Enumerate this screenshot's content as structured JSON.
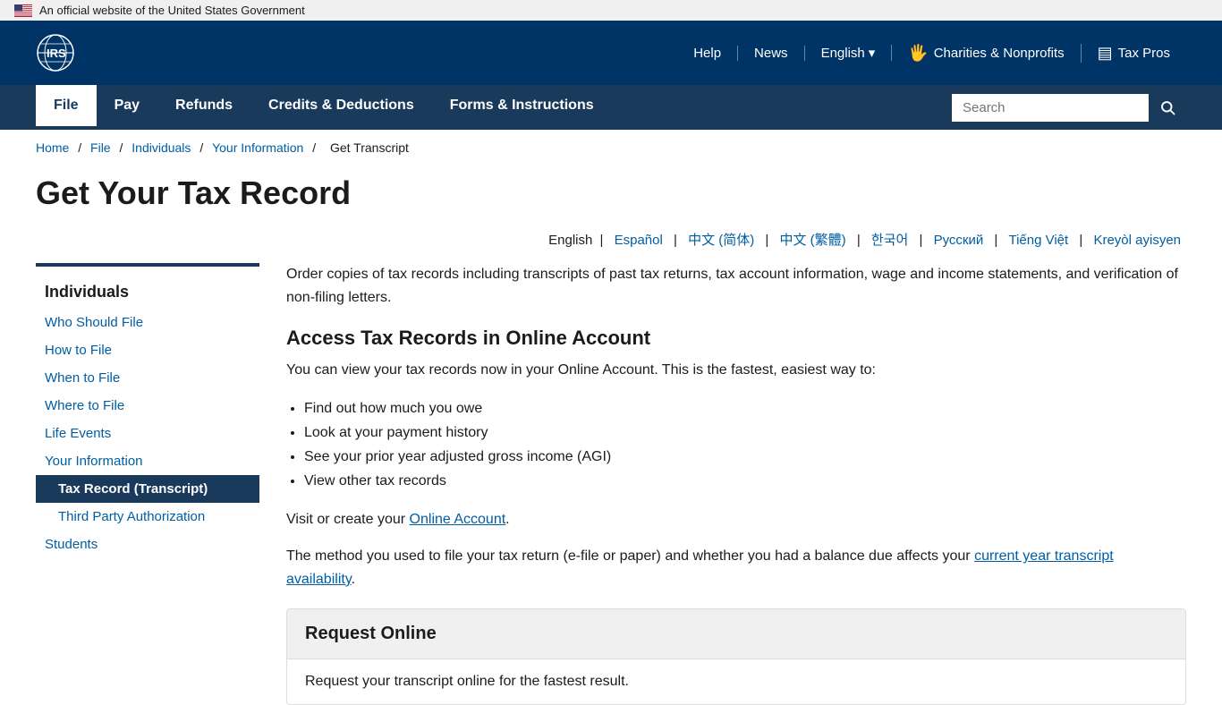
{
  "gov_banner": {
    "text": "An official website of the United States Government"
  },
  "header": {
    "logo_text": "IRS",
    "nav_links": [
      {
        "label": "Help",
        "id": "help"
      },
      {
        "label": "News",
        "id": "news"
      },
      {
        "label": "English",
        "id": "english",
        "has_dropdown": true
      },
      {
        "label": "Charities & Nonprofits",
        "id": "charities"
      },
      {
        "label": "Tax Pros",
        "id": "tax-pros"
      }
    ]
  },
  "main_nav": {
    "items": [
      {
        "label": "File",
        "id": "file",
        "active": true
      },
      {
        "label": "Pay",
        "id": "pay"
      },
      {
        "label": "Refunds",
        "id": "refunds"
      },
      {
        "label": "Credits & Deductions",
        "id": "credits"
      },
      {
        "label": "Forms & Instructions",
        "id": "forms"
      }
    ],
    "search_placeholder": "Search"
  },
  "breadcrumb": {
    "items": [
      {
        "label": "Home",
        "href": "#"
      },
      {
        "label": "File",
        "href": "#"
      },
      {
        "label": "Individuals",
        "href": "#"
      },
      {
        "label": "Your Information",
        "href": "#"
      },
      {
        "label": "Get Transcript",
        "href": null
      }
    ]
  },
  "page_title": "Get Your Tax Record",
  "lang_bar": {
    "current": "English",
    "links": [
      {
        "label": "Español"
      },
      {
        "label": "中文 (简体)"
      },
      {
        "label": "中文 (繁體)"
      },
      {
        "label": "한국어"
      },
      {
        "label": "Русский"
      },
      {
        "label": "Tiếng Việt"
      },
      {
        "label": "Kreyòl ayisyen"
      }
    ]
  },
  "sidebar": {
    "title": "Individuals",
    "items": [
      {
        "label": "Who Should File",
        "id": "who-should-file",
        "active": false,
        "sub": false
      },
      {
        "label": "How to File",
        "id": "how-to-file",
        "active": false,
        "sub": false
      },
      {
        "label": "When to File",
        "id": "when-to-file",
        "active": false,
        "sub": false
      },
      {
        "label": "Where to File",
        "id": "where-to-file",
        "active": false,
        "sub": false
      },
      {
        "label": "Life Events",
        "id": "life-events",
        "active": false,
        "sub": false
      },
      {
        "label": "Your Information",
        "id": "your-information",
        "active": false,
        "sub": false
      },
      {
        "label": "Tax Record (Transcript)",
        "id": "tax-record",
        "active": true,
        "sub": true
      },
      {
        "label": "Third Party Authorization",
        "id": "third-party",
        "active": false,
        "sub": true
      },
      {
        "label": "Students",
        "id": "students",
        "active": false,
        "sub": false
      }
    ]
  },
  "main_content": {
    "intro": "Order copies of tax records including transcripts of past tax returns, tax account information, wage and income statements, and verification of non-filing letters.",
    "section1_title": "Access Tax Records in Online Account",
    "section1_intro": "You can view your tax records now in your Online Account. This is the fastest, easiest way to:",
    "section1_list": [
      "Find out how much you owe",
      "Look at your payment history",
      "See your prior year adjusted gross income (AGI)",
      "View other tax records"
    ],
    "section1_visit": "Visit or create your",
    "section1_link": "Online Account",
    "section1_end": ".",
    "section1_note": "The method you used to file your tax return (e-file or paper) and whether you had a balance due affects  your",
    "section1_note_link": "current year transcript availability",
    "section1_note_end": ".",
    "request_box": {
      "title": "Request Online",
      "body": "Request your transcript online for the fastest result."
    }
  }
}
